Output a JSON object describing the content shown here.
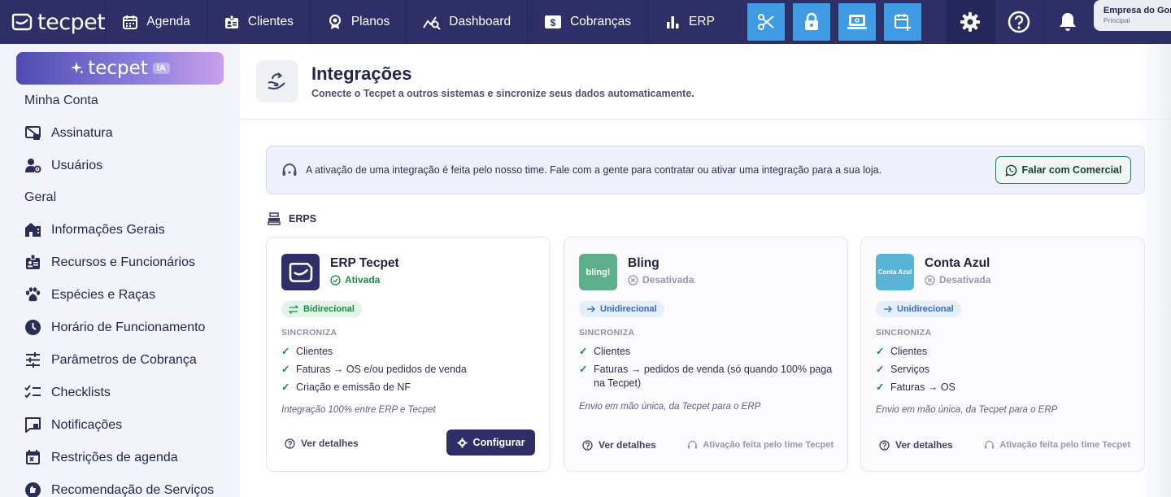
{
  "app": {
    "logo": "tecpet"
  },
  "nav": {
    "items": [
      {
        "label": "Agenda",
        "icon": "calendar-icon"
      },
      {
        "label": "Clientes",
        "icon": "id-badge-icon"
      },
      {
        "label": "Planos",
        "icon": "award-icon"
      },
      {
        "label": "Dashboard",
        "icon": "chart-search-icon"
      },
      {
        "label": "Cobranças",
        "icon": "dollar-icon"
      },
      {
        "label": "ERP",
        "icon": "bar-chart-icon"
      }
    ],
    "quick_actions": [
      "scissors-icon",
      "lock-icon",
      "pos-terminal-icon",
      "calendar-plus-icon"
    ],
    "right_icons": [
      "gear-icon",
      "help-icon",
      "bell-icon"
    ],
    "company": {
      "name": "Empresa do Gomes",
      "subtitle": "Principal"
    }
  },
  "sidebar": {
    "ia_button": {
      "label": "tecpet",
      "badge": "IA"
    },
    "sections": [
      {
        "title": "Minha Conta",
        "items": [
          {
            "label": "Assinatura",
            "icon": "subscription-icon"
          },
          {
            "label": "Usuários",
            "icon": "users-gear-icon"
          }
        ]
      },
      {
        "title": "Geral",
        "items": [
          {
            "label": "Informações Gerais",
            "icon": "building-icon"
          },
          {
            "label": "Recursos e Funcionários",
            "icon": "id-badge-icon"
          },
          {
            "label": "Espécies e Raças",
            "icon": "paw-icon"
          },
          {
            "label": "Horário de Funcionamento",
            "icon": "clock-icon"
          },
          {
            "label": "Parâmetros de Cobrança",
            "icon": "sliders-icon"
          },
          {
            "label": "Checklists",
            "icon": "checklist-icon"
          },
          {
            "label": "Notificações",
            "icon": "message-icon"
          },
          {
            "label": "Restrições de agenda",
            "icon": "calendar-x-icon"
          },
          {
            "label": "Recomendação de Serviços",
            "icon": "recommend-icon"
          }
        ]
      }
    ]
  },
  "page": {
    "title": "Integrações",
    "subtitle": "Conecte o Tecpet a outros sistemas e sincronize seus dados automaticamente.",
    "banner": {
      "text": "A ativação de uma integração é feita pelo nosso time. Fale com a gente para contratar ou ativar uma integração para a sua loja.",
      "button": "Falar com Comercial"
    },
    "section_title": "ERPS"
  },
  "integrations": [
    {
      "name": "ERP Tecpet",
      "logo_text": "",
      "logo_color": "#2d2f66",
      "status": "Ativada",
      "status_color": "#1e8a43",
      "direction": "Bidirecional",
      "sync_label": "SINCRONIZA",
      "sync_items": [
        "Clientes",
        "Faturas → OS e/ou pedidos de venda",
        "Criação e emissão de NF"
      ],
      "note": "Integração 100% entre ERP e Tecpet",
      "details": "Ver detalhes",
      "action": "Configurar"
    },
    {
      "name": "Bling",
      "logo_text": "bling!",
      "logo_color": "#5fae8a",
      "status": "Desativada",
      "status_color": "#9598ad",
      "direction": "Unidirecional",
      "sync_label": "SINCRONIZA",
      "sync_items": [
        "Clientes",
        "Faturas → pedidos de venda (só quando 100% paga na Tecpet)"
      ],
      "note": "Envio em mão única, da Tecpet para o ERP",
      "details": "Ver detalhes",
      "action": "Ativação feita pelo time Tecpet"
    },
    {
      "name": "Conta Azul",
      "logo_text": "Conta Azul",
      "logo_color": "#5ab4d6",
      "status": "Desativada",
      "status_color": "#9598ad",
      "direction": "Unidirecional",
      "sync_label": "SINCRONIZA",
      "sync_items": [
        "Clientes",
        "Serviços",
        "Faturas → OS"
      ],
      "note": "Envio em mão única, da Tecpet para o ERP",
      "details": "Ver detalhes",
      "action": "Ativação feita pelo time Tecpet"
    }
  ]
}
